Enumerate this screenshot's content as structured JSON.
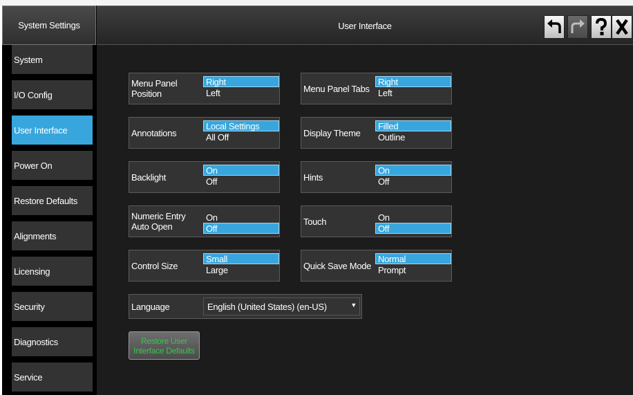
{
  "sidebar": {
    "header": "System Settings",
    "items": [
      {
        "label": "System"
      },
      {
        "label": "I/O Config"
      },
      {
        "label": "User Interface"
      },
      {
        "label": "Power On"
      },
      {
        "label": "Restore Defaults"
      },
      {
        "label": "Alignments"
      },
      {
        "label": "Licensing"
      },
      {
        "label": "Security"
      },
      {
        "label": "Diagnostics"
      },
      {
        "label": "Service"
      }
    ],
    "active_item": "User Interface"
  },
  "header": {
    "title": "User Interface",
    "buttons": [
      {
        "icon": "undo-icon",
        "enabled": true
      },
      {
        "icon": "redo-icon",
        "enabled": false
      },
      {
        "icon": "help-icon",
        "enabled": true
      },
      {
        "icon": "close-icon",
        "enabled": true
      }
    ]
  },
  "settings": {
    "menu_panel_position": {
      "label": "Menu Panel Position",
      "options": [
        "Right",
        "Left"
      ],
      "selected": "Right"
    },
    "menu_panel_tabs": {
      "label": "Menu Panel Tabs",
      "options": [
        "Right",
        "Left"
      ],
      "selected": "Right"
    },
    "annotations": {
      "label": "Annotations",
      "options": [
        "Local Settings",
        "All Off"
      ],
      "selected": "Local Settings"
    },
    "display_theme": {
      "label": "Display Theme",
      "options": [
        "Filled",
        "Outline"
      ],
      "selected": "Filled"
    },
    "backlight": {
      "label": "Backlight",
      "options": [
        "On",
        "Off"
      ],
      "selected": "On"
    },
    "hints": {
      "label": "Hints",
      "options": [
        "On",
        "Off"
      ],
      "selected": "On"
    },
    "numeric_entry": {
      "label_line1": "Numeric Entry",
      "label_line2": "Auto Open",
      "options": [
        "On",
        "Off"
      ],
      "selected": "Off"
    },
    "touch": {
      "label": "Touch",
      "options": [
        "On",
        "Off"
      ],
      "selected": "Off"
    },
    "control_size": {
      "label": "Control Size",
      "options": [
        "Small",
        "Large"
      ],
      "selected": "Small"
    },
    "quick_save_mode": {
      "label": "Quick Save Mode",
      "options": [
        "Normal",
        "Prompt"
      ],
      "selected": "Normal"
    },
    "language": {
      "label": "Language",
      "value": "English (United States) (en-US)"
    }
  },
  "restore_button": {
    "line1": "Restore User",
    "line2": "Interface Defaults"
  },
  "colors": {
    "accent": "#38a6dd",
    "background": "#1c1c1c",
    "panel": "#333333",
    "restore_text": "#34c84a"
  }
}
